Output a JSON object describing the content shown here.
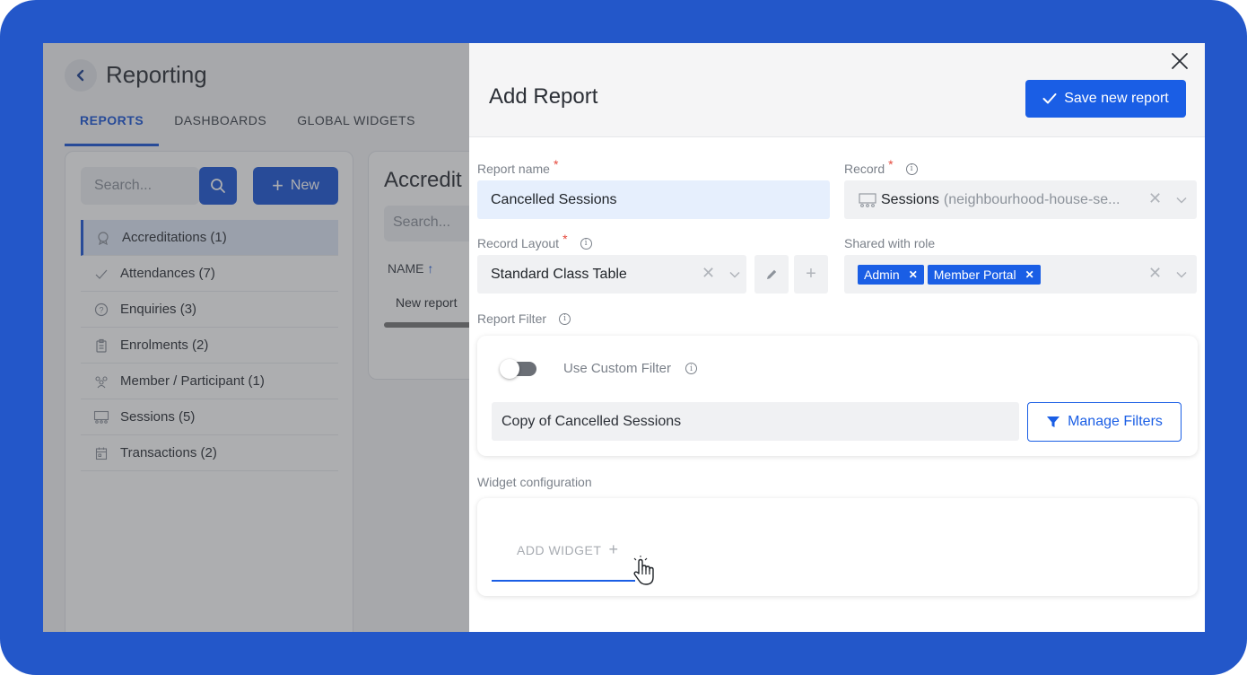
{
  "app": {
    "title": "Reporting",
    "tabs": [
      "REPORTS",
      "DASHBOARDS",
      "GLOBAL WIDGETS"
    ],
    "search_placeholder": "Search...",
    "new_label": "New",
    "records": [
      {
        "label": "Accreditations (1)",
        "icon": "badge-icon"
      },
      {
        "label": "Attendances (7)",
        "icon": "check-icon"
      },
      {
        "label": "Enquiries (3)",
        "icon": "question-icon"
      },
      {
        "label": "Enrolments (2)",
        "icon": "clipboard-icon"
      },
      {
        "label": "Member / Participant (1)",
        "icon": "people-icon"
      },
      {
        "label": "Sessions (5)",
        "icon": "class-icon"
      },
      {
        "label": "Transactions (2)",
        "icon": "calendar-icon"
      }
    ],
    "middle": {
      "title": "Accredit",
      "search_placeholder": "Search...",
      "column": "NAME",
      "row": "New report"
    }
  },
  "drawer": {
    "title": "Add Report",
    "save_label": "Save new report",
    "report_name_label": "Report name",
    "report_name_value": "Cancelled Sessions",
    "record_label": "Record",
    "record_value": "Sessions",
    "record_sub": "(neighbourhood-house-se...",
    "layout_label": "Record Layout",
    "layout_value": "Standard Class Table",
    "shared_label": "Shared with role",
    "roles": [
      "Admin",
      "Member Portal"
    ],
    "filter_label": "Report Filter",
    "custom_filter_label": "Use Custom Filter",
    "custom_filter_on": false,
    "filter_value": "Copy of Cancelled Sessions",
    "manage_label": "Manage Filters",
    "widget_label": "Widget configuration",
    "add_widget_label": "ADD WIDGET"
  },
  "colors": {
    "frame": "#2357c9",
    "primary": "#1a5ee5",
    "required": "#e5483b"
  }
}
